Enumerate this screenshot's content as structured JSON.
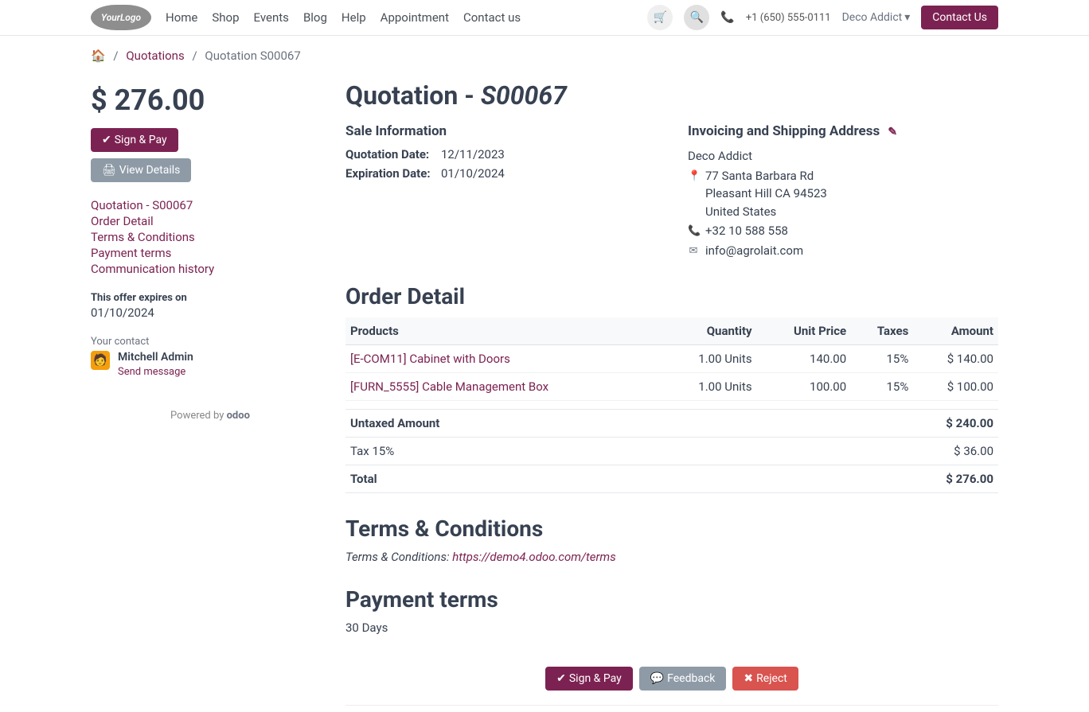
{
  "nav": {
    "links": [
      "Home",
      "Shop",
      "Events",
      "Blog",
      "Help",
      "Appointment",
      "Contact us"
    ],
    "phone": "+1 (650) 555-0111",
    "user": "Deco Addict",
    "contact_us": "Contact Us"
  },
  "breadcrumb": {
    "quotations": "Quotations",
    "current": "Quotation S00067"
  },
  "side": {
    "price": "$ 276.00",
    "sign_pay": "Sign & Pay",
    "view_details": "View Details",
    "links": [
      "Quotation - S00067",
      "Order Detail",
      "Terms & Conditions",
      "Payment terms",
      "Communication history"
    ],
    "expires_label": "This offer expires on",
    "expires_date": "01/10/2024",
    "contact_label": "Your contact",
    "contact_name": "Mitchell Admin",
    "send_message": "Send message",
    "powered_by": "Powered by",
    "brand": "odoo"
  },
  "main": {
    "title_a": "Quotation - ",
    "title_b": "S00067",
    "sale_info": "Sale Information",
    "quotation_date_k": "Quotation Date:",
    "quotation_date_v": "12/11/2023",
    "expiration_date_k": "Expiration Date:",
    "expiration_date_v": "01/10/2024",
    "addr_head": "Invoicing and Shipping Address",
    "addr_name": "Deco Addict",
    "addr_l1": "77 Santa Barbara Rd",
    "addr_l2": "Pleasant Hill CA 94523",
    "addr_l3": "United States",
    "addr_phone": "+32 10 588 558",
    "addr_email": "info@agrolait.com",
    "order_detail": "Order Detail",
    "cols": {
      "products": "Products",
      "qty": "Quantity",
      "unit": "Unit Price",
      "taxes": "Taxes",
      "amount": "Amount"
    },
    "rows": [
      {
        "prod": "[E-COM11] Cabinet with Doors",
        "qty": "1.00 Units",
        "unit": "140.00",
        "tax": "15%",
        "amt": "$ 140.00"
      },
      {
        "prod": "[FURN_5555] Cable Management Box",
        "qty": "1.00 Units",
        "unit": "100.00",
        "tax": "15%",
        "amt": "$ 100.00"
      }
    ],
    "untaxed_k": "Untaxed Amount",
    "untaxed_v": "$ 240.00",
    "tax_k": "Tax 15%",
    "tax_v": "$ 36.00",
    "total_k": "Total",
    "total_v": "$ 276.00",
    "tc_head": "Terms & Conditions",
    "tc_label": "Terms & Conditions: ",
    "tc_url": "https://demo4.odoo.com/terms",
    "pt_head": "Payment terms",
    "pt_value": "30 Days",
    "btn_signpay": "Sign & Pay",
    "btn_feedback": "Feedback",
    "btn_reject": "Reject"
  }
}
